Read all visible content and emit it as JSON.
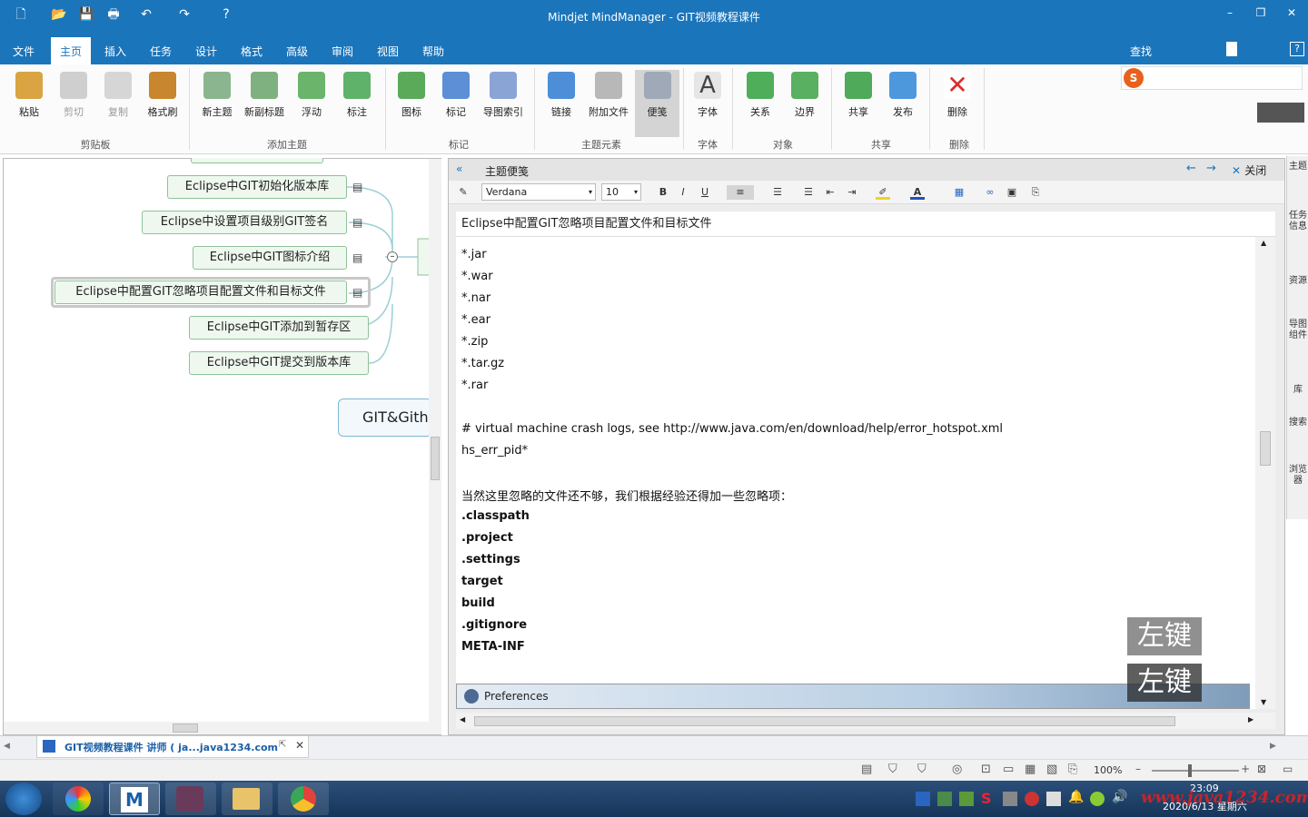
{
  "window": {
    "title": "Mindjet MindManager - GIT视频教程课件"
  },
  "menu": {
    "items": [
      "文件",
      "主页",
      "插入",
      "任务",
      "设计",
      "格式",
      "高级",
      "审阅",
      "视图",
      "帮助"
    ],
    "active": "主页",
    "search_label": "查找"
  },
  "ribbon": {
    "buttons": [
      "粘贴",
      "剪切",
      "复制",
      "格式刷",
      "新主题",
      "新副标题",
      "浮动",
      "标注",
      "图标",
      "标记",
      "导图索引",
      "链接",
      "附加文件",
      "便笺",
      "字体",
      "关系",
      "边界",
      "共享",
      "发布",
      "删除"
    ],
    "groups": [
      "剪贴板",
      "添加主题",
      "标记",
      "主题元素",
      "字体",
      "对象",
      "共享",
      "删除"
    ]
  },
  "mindmap": {
    "topics": [
      "Eclipse中GIT初始化版本库",
      "Eclipse中设置项目级别GIT签名",
      "Eclipse中GIT图标介绍",
      "Eclipse中配置GIT忽略项目配置文件和目标文件",
      "Eclipse中GIT添加到暂存区",
      "Eclipse中GIT提交到版本库"
    ],
    "central": "GIT&Gith",
    "selected_index": 3
  },
  "notes": {
    "header": "主题便笺",
    "close_label": "关闭",
    "font": "Verdana",
    "size": "10",
    "subject": "Eclipse中配置GIT忽略项目配置文件和目标文件",
    "lines": [
      "*.jar",
      "*.war",
      "*.nar",
      "*.ear",
      "*.zip",
      "*.tar.gz",
      "*.rar",
      "",
      "# virtual machine crash logs, see http://www.java.com/en/download/help/error_hotspot.xml",
      "hs_err_pid*",
      "",
      "当然这里忽略的文件还不够，我们根据经验还得加一些忽略项：",
      ".classpath",
      ".project",
      ".settings",
      "target",
      "build",
      ".gitignore",
      "META-INF"
    ],
    "bold_from": 12,
    "embedded_window_title": "Preferences"
  },
  "overlay": {
    "label": "左键"
  },
  "rightbar": {
    "items": [
      "主题",
      "任务信息",
      "资源",
      "导图组件",
      "库",
      "搜索",
      "浏览器"
    ]
  },
  "tabs": {
    "doc": "GIT视频教程课件 讲师 ( ja...java1234.com"
  },
  "status": {
    "zoom": "100%"
  },
  "taskbar": {
    "time": "23:09",
    "date": "2020/6/13 星期六",
    "watermark": "www.java1234.com"
  }
}
